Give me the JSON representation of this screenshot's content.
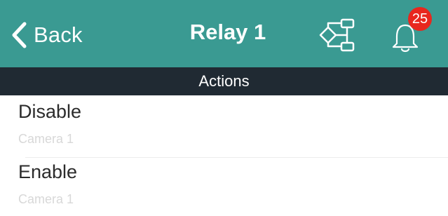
{
  "navbar": {
    "back_label": "Back",
    "title": "Relay 1",
    "notification_count": "25",
    "background_color": "#3a9a92",
    "icons": [
      "chevron-left-icon",
      "flow-diagram-icon",
      "bell-icon"
    ]
  },
  "section": {
    "header": "Actions",
    "background_color": "#202a33"
  },
  "actions": [
    {
      "title": "Disable",
      "subtitle": "Camera 1"
    },
    {
      "title": "Enable",
      "subtitle": "Camera 1"
    }
  ],
  "colors": {
    "badge": "#e8271e"
  }
}
